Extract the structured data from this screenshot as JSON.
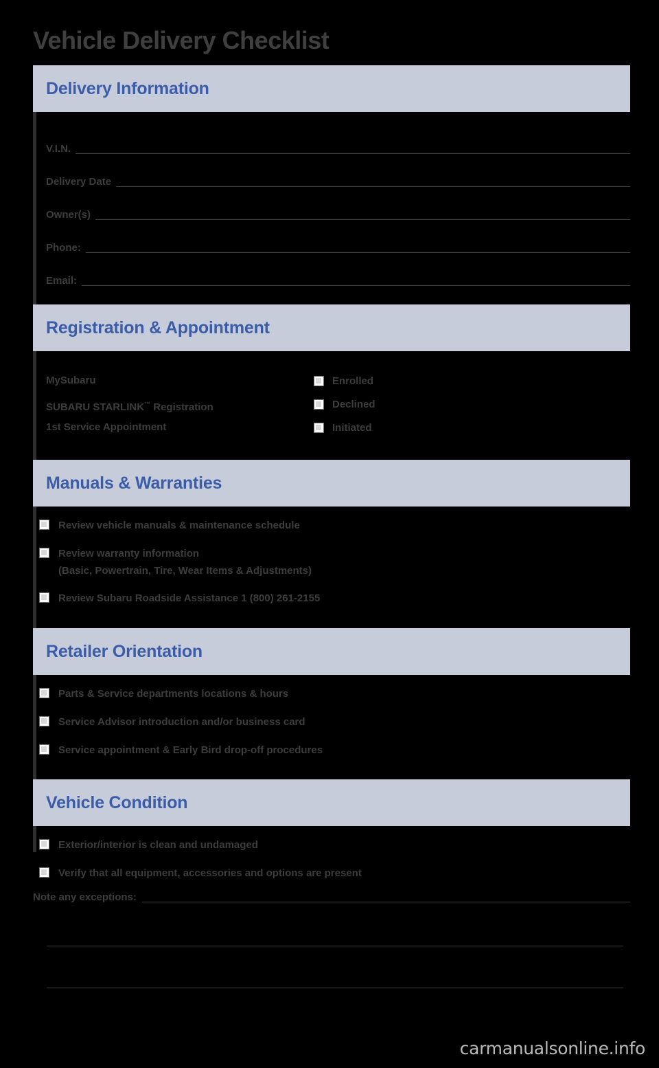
{
  "document": {
    "title": "Vehicle Delivery Checklist",
    "watermark": "carmanualsonline.info"
  },
  "sections": [
    {
      "heading": "Delivery Information",
      "type": "fields",
      "fields": [
        {
          "label": "V.I.N."
        },
        {
          "label": "Delivery Date"
        },
        {
          "label": "Owner(s)"
        },
        {
          "label": "Phone:"
        },
        {
          "label": "Email:"
        }
      ]
    },
    {
      "heading": "Registration & Appointment",
      "type": "registration",
      "items": [
        {
          "label": "MySubaru",
          "sup": ""
        },
        {
          "label": "SUBARU STARLINK",
          "sup": "™",
          "suffix": " Registration"
        },
        {
          "label": "1st Service Appointment",
          "sup": ""
        }
      ],
      "options": [
        "Enrolled",
        "Declined",
        "Initiated"
      ]
    },
    {
      "heading": "Manuals & Warranties",
      "type": "checklist",
      "items": [
        {
          "text": "Review vehicle manuals & maintenance schedule"
        },
        {
          "text": "Review warranty information\n(Basic, Powertrain, Tire, Wear Items & Adjustments)"
        },
        {
          "text": "Review Subaru Roadside Assistance 1 (800) 261-2155"
        }
      ]
    },
    {
      "heading": "Retailer Orientation",
      "type": "checklist",
      "items": [
        {
          "text": "Parts & Service departments locations & hours"
        },
        {
          "text": "Service Advisor introduction and/or business card"
        },
        {
          "text": "Service appointment & Early Bird drop-off procedures"
        }
      ]
    },
    {
      "heading": "Vehicle Condition",
      "type": "checklist",
      "items": [
        {
          "text": "Exterior/interior is clean and undamaged"
        },
        {
          "text": "Verify that all equipment, accessories and options are present"
        }
      ]
    }
  ],
  "notes": {
    "label": "Note any exceptions:"
  },
  "colors": {
    "band": "#c7ccdb",
    "heading": "#3b5ca8",
    "text": "#3d3d3d",
    "background": "#000000"
  }
}
